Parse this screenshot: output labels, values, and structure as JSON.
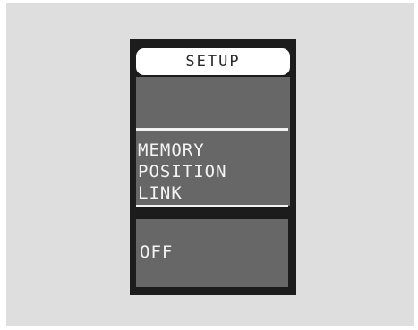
{
  "screen": {
    "header": "SETUP",
    "menu_lines": [
      "MEMORY",
      "POSITION",
      "LINK"
    ],
    "value": "OFF"
  },
  "colors": {
    "backdrop": "#dedede",
    "bezel": "#1c1c1c",
    "panel": "#676767",
    "text": "#f4f4f4",
    "header_bg": "#ffffff"
  }
}
